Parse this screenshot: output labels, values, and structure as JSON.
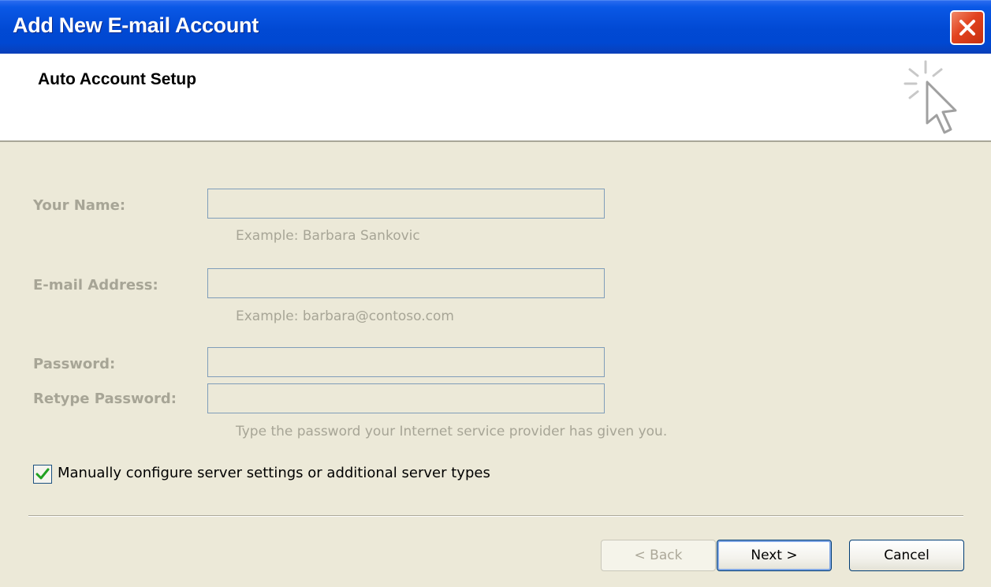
{
  "window": {
    "title": "Add New E-mail Account",
    "close_icon": "close-icon"
  },
  "header": {
    "heading": "Auto Account Setup",
    "icon": "cursor-sparkle-icon"
  },
  "form": {
    "name_label": "Your Name:",
    "name_value": "",
    "name_hint": "Example: Barbara Sankovic",
    "email_label": "E-mail Address:",
    "email_value": "",
    "email_hint": "Example: barbara@contoso.com",
    "password_label": "Password:",
    "password_value": "",
    "retype_label": "Retype Password:",
    "retype_value": "",
    "password_hint": "Type the password your Internet service provider has given you."
  },
  "manual_config": {
    "label": "Manually configure server settings or additional server types",
    "checked": true
  },
  "buttons": {
    "back": "< Back",
    "next": "Next >",
    "cancel": "Cancel"
  },
  "colors": {
    "titlebar": "#0149d3",
    "dialog_bg": "#ece9d8",
    "disabled_text": "#a7a596",
    "close_red": "#e2431f",
    "check_green": "#21a121"
  }
}
